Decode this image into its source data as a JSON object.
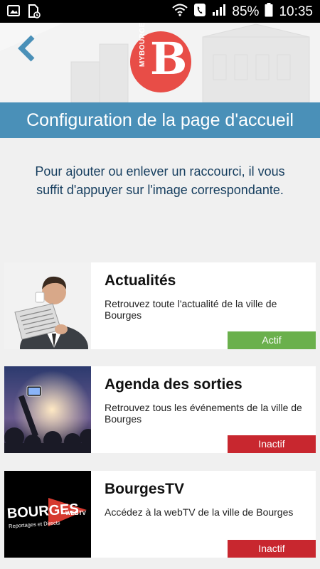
{
  "statusbar": {
    "battery_percent": "85%",
    "time": "10:35",
    "icons": [
      "image-icon",
      "download-sim-icon",
      "wifi-icon",
      "call-icon",
      "signal-icon",
      "battery-icon"
    ]
  },
  "header": {
    "back_icon": "chevron-left-icon",
    "logo_letter": "B",
    "logo_text": "MYBOURGES"
  },
  "title": "Configuration de la page d'accueil",
  "instructions": "Pour ajouter ou enlever un raccourci, il vous suffit d'appuyer sur l'image correspondante.",
  "shortcuts": [
    {
      "title": "Actualités",
      "description": "Retrouvez toute l'actualité de la ville de Bourges",
      "status": "Actif",
      "status_color": "#6ab04c"
    },
    {
      "title": "Agenda des sorties",
      "description": "Retrouvez tous les événements de la ville de Bourges",
      "status": "Inactif",
      "status_color": "#c8272f"
    },
    {
      "title": "BourgesTV",
      "description": "Accédez à la webTV de la ville de Bourges",
      "status": "Inactif",
      "status_color": "#c8272f",
      "image_text": "BOURGES",
      "image_subtext": "Reportages et Directs",
      "image_badge": "WEBTV"
    }
  ],
  "colors": {
    "title_bar": "#4a90b8",
    "logo": "#e84d47",
    "instructions_text": "#153d5e"
  }
}
